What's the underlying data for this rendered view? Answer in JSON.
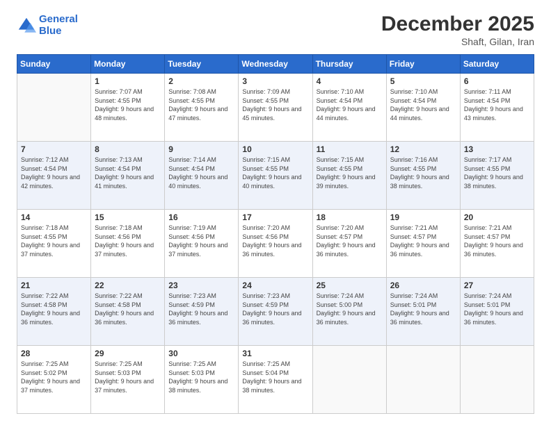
{
  "logo": {
    "line1": "General",
    "line2": "Blue"
  },
  "title": "December 2025",
  "location": "Shaft, Gilan, Iran",
  "days_header": [
    "Sunday",
    "Monday",
    "Tuesday",
    "Wednesday",
    "Thursday",
    "Friday",
    "Saturday"
  ],
  "weeks": [
    [
      {
        "day": "",
        "sunrise": "",
        "sunset": "",
        "daylight": ""
      },
      {
        "day": "1",
        "sunrise": "Sunrise: 7:07 AM",
        "sunset": "Sunset: 4:55 PM",
        "daylight": "Daylight: 9 hours and 48 minutes."
      },
      {
        "day": "2",
        "sunrise": "Sunrise: 7:08 AM",
        "sunset": "Sunset: 4:55 PM",
        "daylight": "Daylight: 9 hours and 47 minutes."
      },
      {
        "day": "3",
        "sunrise": "Sunrise: 7:09 AM",
        "sunset": "Sunset: 4:55 PM",
        "daylight": "Daylight: 9 hours and 45 minutes."
      },
      {
        "day": "4",
        "sunrise": "Sunrise: 7:10 AM",
        "sunset": "Sunset: 4:54 PM",
        "daylight": "Daylight: 9 hours and 44 minutes."
      },
      {
        "day": "5",
        "sunrise": "Sunrise: 7:10 AM",
        "sunset": "Sunset: 4:54 PM",
        "daylight": "Daylight: 9 hours and 44 minutes."
      },
      {
        "day": "6",
        "sunrise": "Sunrise: 7:11 AM",
        "sunset": "Sunset: 4:54 PM",
        "daylight": "Daylight: 9 hours and 43 minutes."
      }
    ],
    [
      {
        "day": "7",
        "sunrise": "Sunrise: 7:12 AM",
        "sunset": "Sunset: 4:54 PM",
        "daylight": "Daylight: 9 hours and 42 minutes."
      },
      {
        "day": "8",
        "sunrise": "Sunrise: 7:13 AM",
        "sunset": "Sunset: 4:54 PM",
        "daylight": "Daylight: 9 hours and 41 minutes."
      },
      {
        "day": "9",
        "sunrise": "Sunrise: 7:14 AM",
        "sunset": "Sunset: 4:54 PM",
        "daylight": "Daylight: 9 hours and 40 minutes."
      },
      {
        "day": "10",
        "sunrise": "Sunrise: 7:15 AM",
        "sunset": "Sunset: 4:55 PM",
        "daylight": "Daylight: 9 hours and 40 minutes."
      },
      {
        "day": "11",
        "sunrise": "Sunrise: 7:15 AM",
        "sunset": "Sunset: 4:55 PM",
        "daylight": "Daylight: 9 hours and 39 minutes."
      },
      {
        "day": "12",
        "sunrise": "Sunrise: 7:16 AM",
        "sunset": "Sunset: 4:55 PM",
        "daylight": "Daylight: 9 hours and 38 minutes."
      },
      {
        "day": "13",
        "sunrise": "Sunrise: 7:17 AM",
        "sunset": "Sunset: 4:55 PM",
        "daylight": "Daylight: 9 hours and 38 minutes."
      }
    ],
    [
      {
        "day": "14",
        "sunrise": "Sunrise: 7:18 AM",
        "sunset": "Sunset: 4:55 PM",
        "daylight": "Daylight: 9 hours and 37 minutes."
      },
      {
        "day": "15",
        "sunrise": "Sunrise: 7:18 AM",
        "sunset": "Sunset: 4:56 PM",
        "daylight": "Daylight: 9 hours and 37 minutes."
      },
      {
        "day": "16",
        "sunrise": "Sunrise: 7:19 AM",
        "sunset": "Sunset: 4:56 PM",
        "daylight": "Daylight: 9 hours and 37 minutes."
      },
      {
        "day": "17",
        "sunrise": "Sunrise: 7:20 AM",
        "sunset": "Sunset: 4:56 PM",
        "daylight": "Daylight: 9 hours and 36 minutes."
      },
      {
        "day": "18",
        "sunrise": "Sunrise: 7:20 AM",
        "sunset": "Sunset: 4:57 PM",
        "daylight": "Daylight: 9 hours and 36 minutes."
      },
      {
        "day": "19",
        "sunrise": "Sunrise: 7:21 AM",
        "sunset": "Sunset: 4:57 PM",
        "daylight": "Daylight: 9 hours and 36 minutes."
      },
      {
        "day": "20",
        "sunrise": "Sunrise: 7:21 AM",
        "sunset": "Sunset: 4:57 PM",
        "daylight": "Daylight: 9 hours and 36 minutes."
      }
    ],
    [
      {
        "day": "21",
        "sunrise": "Sunrise: 7:22 AM",
        "sunset": "Sunset: 4:58 PM",
        "daylight": "Daylight: 9 hours and 36 minutes."
      },
      {
        "day": "22",
        "sunrise": "Sunrise: 7:22 AM",
        "sunset": "Sunset: 4:58 PM",
        "daylight": "Daylight: 9 hours and 36 minutes."
      },
      {
        "day": "23",
        "sunrise": "Sunrise: 7:23 AM",
        "sunset": "Sunset: 4:59 PM",
        "daylight": "Daylight: 9 hours and 36 minutes."
      },
      {
        "day": "24",
        "sunrise": "Sunrise: 7:23 AM",
        "sunset": "Sunset: 4:59 PM",
        "daylight": "Daylight: 9 hours and 36 minutes."
      },
      {
        "day": "25",
        "sunrise": "Sunrise: 7:24 AM",
        "sunset": "Sunset: 5:00 PM",
        "daylight": "Daylight: 9 hours and 36 minutes."
      },
      {
        "day": "26",
        "sunrise": "Sunrise: 7:24 AM",
        "sunset": "Sunset: 5:01 PM",
        "daylight": "Daylight: 9 hours and 36 minutes."
      },
      {
        "day": "27",
        "sunrise": "Sunrise: 7:24 AM",
        "sunset": "Sunset: 5:01 PM",
        "daylight": "Daylight: 9 hours and 36 minutes."
      }
    ],
    [
      {
        "day": "28",
        "sunrise": "Sunrise: 7:25 AM",
        "sunset": "Sunset: 5:02 PM",
        "daylight": "Daylight: 9 hours and 37 minutes."
      },
      {
        "day": "29",
        "sunrise": "Sunrise: 7:25 AM",
        "sunset": "Sunset: 5:03 PM",
        "daylight": "Daylight: 9 hours and 37 minutes."
      },
      {
        "day": "30",
        "sunrise": "Sunrise: 7:25 AM",
        "sunset": "Sunset: 5:03 PM",
        "daylight": "Daylight: 9 hours and 38 minutes."
      },
      {
        "day": "31",
        "sunrise": "Sunrise: 7:25 AM",
        "sunset": "Sunset: 5:04 PM",
        "daylight": "Daylight: 9 hours and 38 minutes."
      },
      {
        "day": "",
        "sunrise": "",
        "sunset": "",
        "daylight": ""
      },
      {
        "day": "",
        "sunrise": "",
        "sunset": "",
        "daylight": ""
      },
      {
        "day": "",
        "sunrise": "",
        "sunset": "",
        "daylight": ""
      }
    ]
  ]
}
